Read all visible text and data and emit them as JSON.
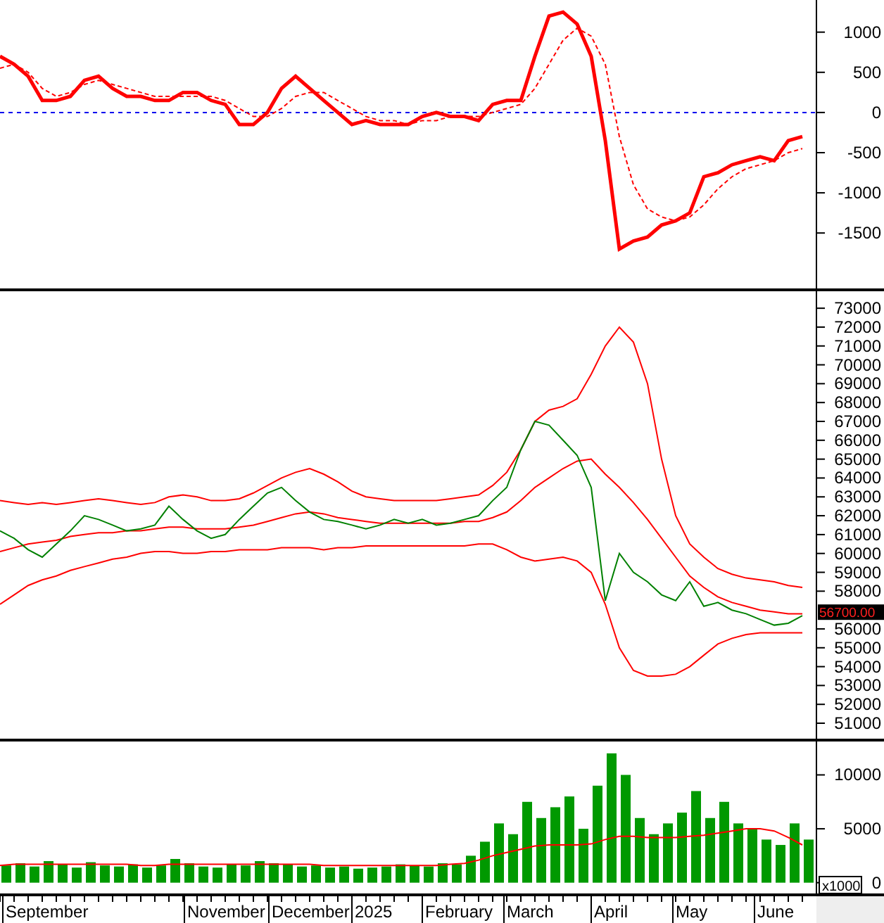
{
  "macd_panel": {
    "chart_data": {
      "type": "line",
      "ylim": [
        -2190,
        1400
      ],
      "yticks": [
        1000,
        500,
        0,
        -500,
        -1000,
        -1500
      ],
      "ref_lines": [
        {
          "axis": "y",
          "value": 0,
          "color": "#0000ee",
          "line_style": "dashed"
        }
      ],
      "series": [
        {
          "color": "#ff0000",
          "line_style": "solid",
          "values": [
            700,
            600,
            450,
            150,
            150,
            200,
            400,
            450,
            300,
            200,
            200,
            150,
            150,
            250,
            250,
            150,
            100,
            -150,
            -150,
            0,
            300,
            450,
            300,
            150,
            0,
            -150,
            -100,
            -150,
            -150,
            -150,
            -50,
            0,
            -50,
            -50,
            -100,
            100,
            150,
            150,
            700,
            1200,
            1250,
            1100,
            700,
            -350,
            -1700,
            -1600,
            -1550,
            -1400,
            -1350,
            -1250,
            -800,
            -750,
            -650,
            -600,
            -550,
            -600,
            -350,
            -300
          ]
        },
        {
          "color": "#ff0000",
          "line_style": "dashed",
          "values": [
            550,
            600,
            500,
            300,
            200,
            250,
            350,
            400,
            350,
            300,
            250,
            200,
            200,
            200,
            200,
            200,
            150,
            50,
            -50,
            -50,
            50,
            200,
            250,
            250,
            150,
            50,
            -50,
            -100,
            -100,
            -150,
            -100,
            -100,
            -50,
            -50,
            -50,
            0,
            50,
            100,
            300,
            600,
            900,
            1050,
            950,
            600,
            -300,
            -900,
            -1200,
            -1300,
            -1350,
            -1300,
            -1150,
            -950,
            -800,
            -700,
            -650,
            -600,
            -500,
            -450
          ]
        }
      ]
    }
  },
  "price_panel": {
    "last_price_label": "56700.00",
    "chart_data": {
      "type": "line",
      "ylim": [
        50180,
        73900
      ],
      "yticks": [
        73000,
        72000,
        71000,
        70000,
        69000,
        68000,
        67000,
        66000,
        65000,
        64000,
        63000,
        62000,
        61000,
        60000,
        59000,
        58000,
        56000,
        55000,
        54000,
        53000,
        52000,
        51000
      ],
      "series": [
        {
          "color": "#ff0000",
          "line_style": "solid",
          "values": [
            62800,
            62700,
            62600,
            62700,
            62600,
            62700,
            62800,
            62900,
            62800,
            62700,
            62600,
            62700,
            63000,
            63100,
            63000,
            62800,
            62800,
            62900,
            63200,
            63600,
            64000,
            64300,
            64500,
            64200,
            63800,
            63300,
            63000,
            62900,
            62800,
            62800,
            62800,
            62800,
            62900,
            63000,
            63100,
            63600,
            64300,
            65500,
            67000,
            67600,
            67800,
            68200,
            69500,
            71000,
            72000,
            71200,
            69000,
            65000,
            62000,
            60500,
            59800,
            59200,
            58900,
            58700,
            58600,
            58500,
            58300,
            58200
          ]
        },
        {
          "color": "#ff0000",
          "line_style": "solid",
          "values": [
            60100,
            60300,
            60500,
            60600,
            60700,
            60900,
            61000,
            61100,
            61100,
            61200,
            61200,
            61300,
            61400,
            61400,
            61300,
            61300,
            61300,
            61400,
            61500,
            61700,
            61900,
            62100,
            62200,
            62100,
            61900,
            61800,
            61700,
            61600,
            61600,
            61600,
            61600,
            61600,
            61600,
            61700,
            61700,
            61900,
            62200,
            62800,
            63500,
            64000,
            64500,
            64900,
            65000,
            64200,
            63500,
            62700,
            61800,
            60800,
            59800,
            58800,
            58200,
            57700,
            57400,
            57200,
            57000,
            56900,
            56800,
            56800
          ]
        },
        {
          "color": "#ff0000",
          "line_style": "solid",
          "values": [
            57300,
            57800,
            58300,
            58600,
            58800,
            59100,
            59300,
            59500,
            59700,
            59800,
            60000,
            60100,
            60100,
            60000,
            60000,
            60100,
            60100,
            60200,
            60200,
            60200,
            60300,
            60300,
            60300,
            60200,
            60300,
            60300,
            60400,
            60400,
            60400,
            60400,
            60400,
            60400,
            60400,
            60400,
            60500,
            60500,
            60200,
            59800,
            59600,
            59700,
            59800,
            59600,
            59000,
            57300,
            55000,
            53800,
            53500,
            53500,
            53600,
            54000,
            54600,
            55200,
            55500,
            55700,
            55800,
            55800,
            55800,
            55800
          ]
        },
        {
          "color": "#008000",
          "line_style": "solid",
          "values": [
            61200,
            60800,
            60200,
            59800,
            60500,
            61200,
            62000,
            61800,
            61500,
            61200,
            61300,
            61500,
            62500,
            61800,
            61200,
            60800,
            61000,
            61800,
            62500,
            63200,
            63500,
            62800,
            62200,
            61800,
            61700,
            61500,
            61300,
            61500,
            61800,
            61600,
            61800,
            61500,
            61600,
            61800,
            62000,
            62800,
            63500,
            65500,
            67000,
            66800,
            66000,
            65200,
            63500,
            57500,
            60000,
            59000,
            58500,
            57800,
            57500,
            58500,
            57200,
            57400,
            57000,
            56800,
            56500,
            56200,
            56300,
            56700
          ]
        }
      ]
    }
  },
  "volume_panel": {
    "unit_label": "x1000",
    "chart_data": {
      "type": "bar",
      "ylim": [
        -1000,
        13100
      ],
      "yticks": [
        10000,
        5000,
        0
      ],
      "series": [
        {
          "color": "#009900",
          "values": [
            1600,
            1800,
            1500,
            2000,
            1700,
            1400,
            1900,
            1600,
            1500,
            1700,
            1400,
            1600,
            2200,
            1800,
            1500,
            1400,
            1700,
            1600,
            2000,
            1800,
            1700,
            1500,
            1600,
            1400,
            1500,
            1300,
            1400,
            1500,
            1700,
            1600,
            1500,
            1800,
            1700,
            2500,
            3800,
            5500,
            4500,
            7500,
            6000,
            7000,
            8000,
            5000,
            9000,
            12000,
            10000,
            6000,
            4500,
            5500,
            6500,
            8500,
            6000,
            7500,
            5500,
            5000,
            4000,
            3500,
            5500,
            4000
          ]
        },
        {
          "type": "line",
          "color": "#ff0000",
          "line_style": "solid",
          "values": [
            1600,
            1700,
            1700,
            1700,
            1700,
            1700,
            1700,
            1700,
            1700,
            1700,
            1600,
            1600,
            1700,
            1700,
            1700,
            1700,
            1700,
            1700,
            1700,
            1700,
            1700,
            1700,
            1700,
            1600,
            1600,
            1600,
            1600,
            1600,
            1600,
            1600,
            1600,
            1600,
            1700,
            1800,
            2100,
            2500,
            2800,
            3100,
            3400,
            3500,
            3500,
            3500,
            3600,
            4000,
            4300,
            4300,
            4200,
            4200,
            4200,
            4300,
            4400,
            4600,
            4800,
            5000,
            5000,
            4800,
            4200,
            3500
          ]
        }
      ]
    }
  },
  "time_axis": {
    "labels": [
      "September",
      "November",
      "December",
      "2025",
      "February",
      "March",
      "April",
      "May",
      "June"
    ]
  }
}
